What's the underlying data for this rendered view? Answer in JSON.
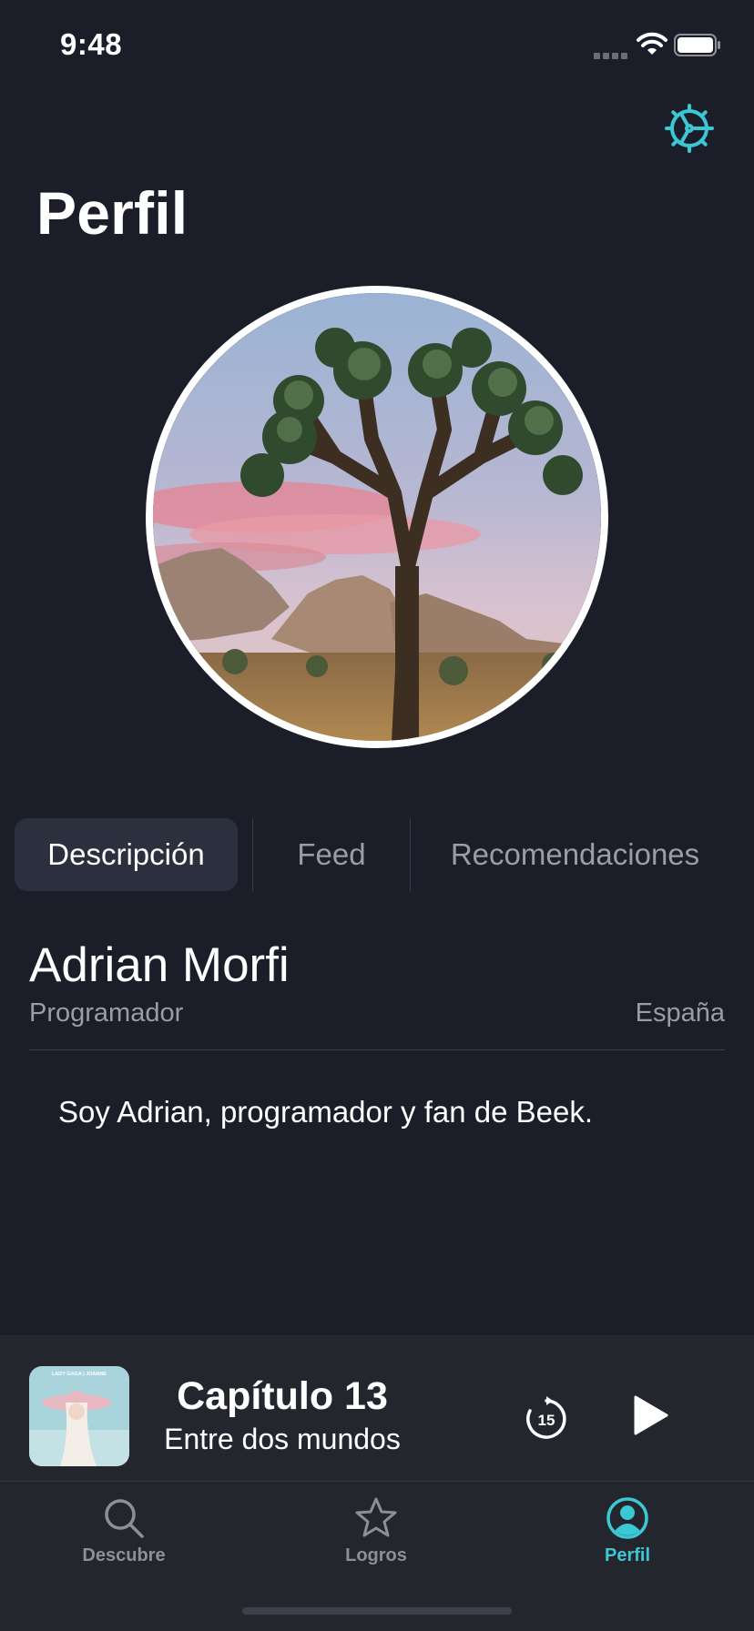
{
  "status_bar": {
    "time": "9:48",
    "wifi_icon": "wifi-icon",
    "battery_icon": "battery-icon",
    "signal_icon": "cellular-signal-icon"
  },
  "header": {
    "title": "Perfil",
    "settings_icon": "gear-icon"
  },
  "colors": {
    "background": "#1b1d29",
    "accent": "#3bc7d4",
    "secondary_text": "#9a9ca6",
    "panel": "#24262e",
    "active_segment": "#2b2f3e"
  },
  "tabs": [
    {
      "label": "Descripción",
      "active": true
    },
    {
      "label": "Feed",
      "active": false
    },
    {
      "label": "Recomendaciones",
      "active": false
    }
  ],
  "profile": {
    "name": "Adrian Morfi",
    "role": "Programador",
    "country": "España",
    "bio": "Soy Adrian, programador y fan de Beek."
  },
  "player": {
    "album_art_text": "LADY GAGA | JOANNE",
    "title": "Capítulo 13",
    "subtitle": "Entre dos mundos",
    "skip_back_seconds": "15",
    "play_icon": "play-icon"
  },
  "tab_bar": {
    "items": [
      {
        "label": "Descubre",
        "icon": "search-icon",
        "active": false
      },
      {
        "label": "Logros",
        "icon": "star-icon",
        "active": false
      },
      {
        "label": "Perfil",
        "icon": "profile-icon",
        "active": true
      }
    ]
  }
}
